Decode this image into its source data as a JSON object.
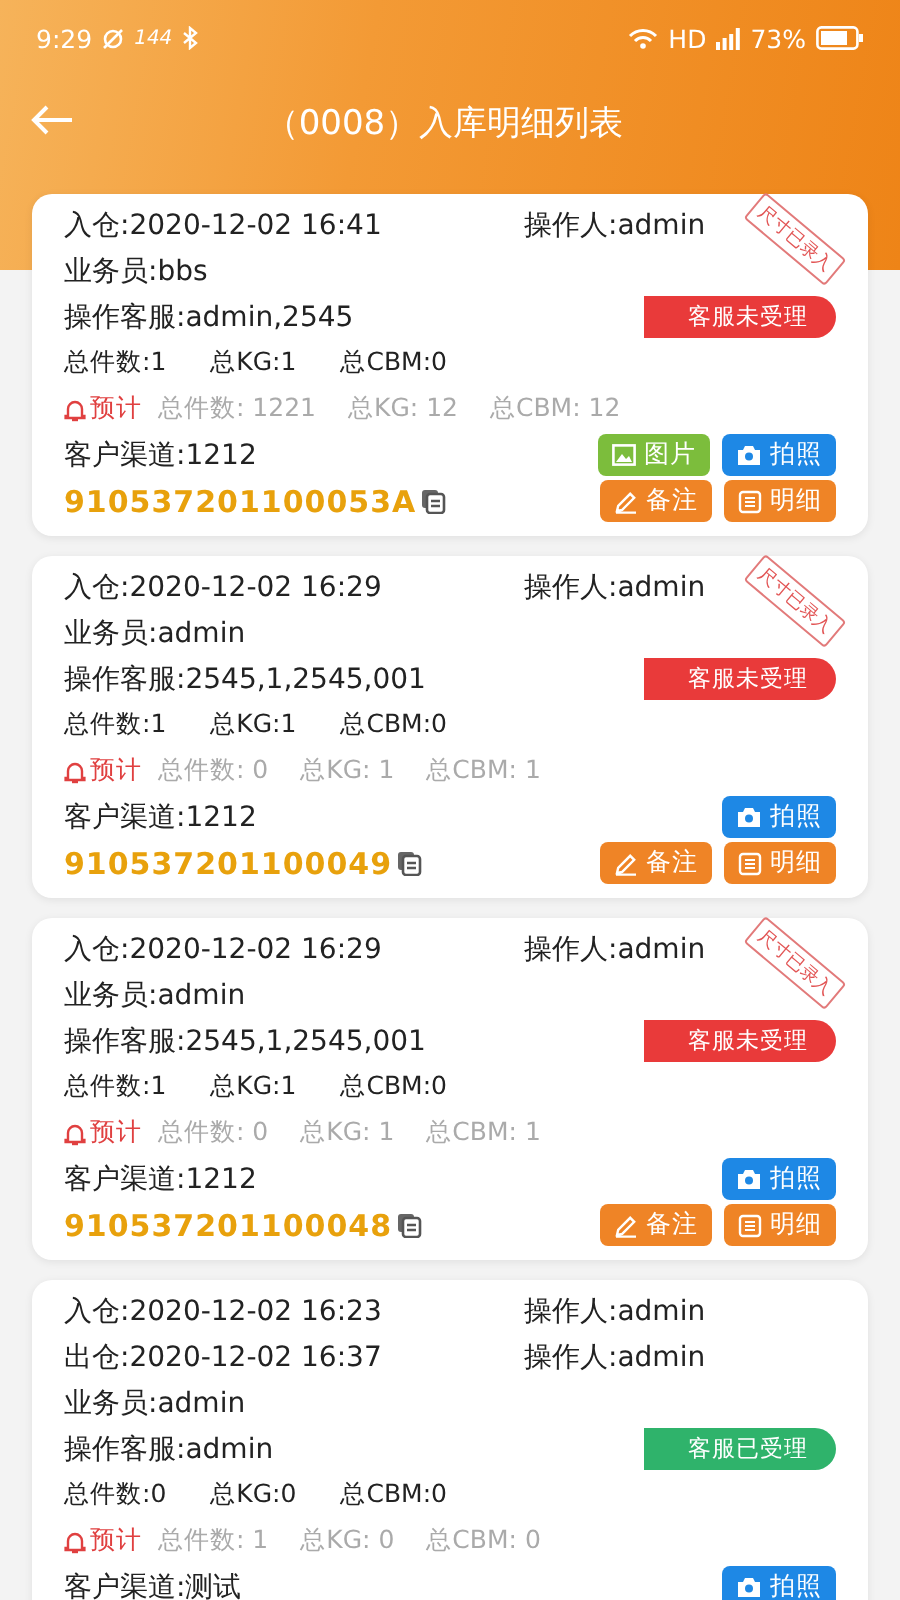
{
  "status_bar": {
    "time": "9:29",
    "speed": "144",
    "network": "HD",
    "battery": "73%"
  },
  "header": {
    "title": "（0008）入库明细列表"
  },
  "records": [
    {
      "times": [
        {
          "label": "入仓:2020-12-02 16:41",
          "operator": "操作人:admin"
        }
      ],
      "stamp": "尺寸已录入",
      "salesman": "业务员:bbs",
      "service": "操作客服:admin,2545",
      "status": {
        "kind": "pending",
        "label": "客服未受理"
      },
      "totals": [
        "总件数:1",
        "总KG:1",
        "总CBM:0"
      ],
      "forecast": {
        "label": "预计",
        "values": [
          "总件数: 1221",
          "总KG: 12",
          "总CBM: 12"
        ]
      },
      "channel": "客户渠道:1212",
      "channel_buttons": [
        {
          "kind": "picture",
          "label": "图片"
        },
        {
          "kind": "photo",
          "label": "拍照"
        }
      ],
      "code": "910537201100053A",
      "code_buttons": [
        {
          "kind": "note",
          "label": "备注"
        },
        {
          "kind": "detail",
          "label": "明细"
        }
      ]
    },
    {
      "times": [
        {
          "label": "入仓:2020-12-02 16:29",
          "operator": "操作人:admin"
        }
      ],
      "stamp": "尺寸已录入",
      "salesman": "业务员:admin",
      "service": "操作客服:2545,1,2545,001",
      "status": {
        "kind": "pending",
        "label": "客服未受理"
      },
      "totals": [
        "总件数:1",
        "总KG:1",
        "总CBM:0"
      ],
      "forecast": {
        "label": "预计",
        "values": [
          "总件数: 0",
          "总KG: 1",
          "总CBM: 1"
        ]
      },
      "channel": "客户渠道:1212",
      "channel_buttons": [
        {
          "kind": "photo",
          "label": "拍照"
        }
      ],
      "code": "910537201100049",
      "code_buttons": [
        {
          "kind": "note",
          "label": "备注"
        },
        {
          "kind": "detail",
          "label": "明细"
        }
      ]
    },
    {
      "times": [
        {
          "label": "入仓:2020-12-02 16:29",
          "operator": "操作人:admin"
        }
      ],
      "stamp": "尺寸已录入",
      "salesman": "业务员:admin",
      "service": "操作客服:2545,1,2545,001",
      "status": {
        "kind": "pending",
        "label": "客服未受理"
      },
      "totals": [
        "总件数:1",
        "总KG:1",
        "总CBM:0"
      ],
      "forecast": {
        "label": "预计",
        "values": [
          "总件数: 0",
          "总KG: 1",
          "总CBM: 1"
        ]
      },
      "channel": "客户渠道:1212",
      "channel_buttons": [
        {
          "kind": "photo",
          "label": "拍照"
        }
      ],
      "code": "910537201100048",
      "code_buttons": [
        {
          "kind": "note",
          "label": "备注"
        },
        {
          "kind": "detail",
          "label": "明细"
        }
      ]
    },
    {
      "times": [
        {
          "label": "入仓:2020-12-02 16:23",
          "operator": "操作人:admin"
        },
        {
          "label": "出仓:2020-12-02 16:37",
          "operator": "操作人:admin"
        }
      ],
      "salesman": "业务员:admin",
      "service": "操作客服:admin",
      "status": {
        "kind": "accepted",
        "label": "客服已受理"
      },
      "totals": [
        "总件数:0",
        "总KG:0",
        "总CBM:0"
      ],
      "forecast": {
        "label": "预计",
        "values": [
          "总件数: 1",
          "总KG: 0",
          "总CBM: 0"
        ]
      },
      "channel": "客户渠道:测试",
      "channel_buttons": [
        {
          "kind": "photo",
          "label": "拍照"
        }
      ]
    }
  ]
}
